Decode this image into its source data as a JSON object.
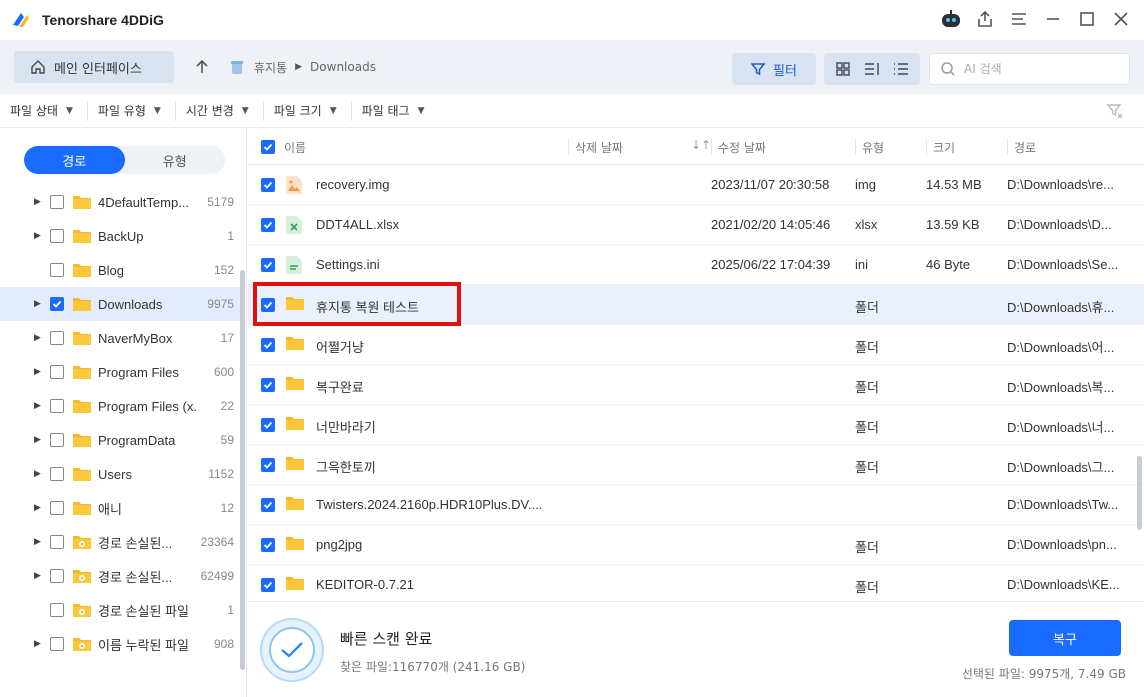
{
  "window": {
    "title": "Tenorshare 4DDiG"
  },
  "toolbar": {
    "home_label": "메인 인터페이스",
    "breadcrumb": [
      "휴지통",
      "Downloads"
    ],
    "filter_label": "필터",
    "search_placeholder": "AI 검색"
  },
  "filters": [
    "파일 상태",
    "파일 유형",
    "시간 변경",
    "파일 크기",
    "파일 태그"
  ],
  "sidebar": {
    "tabs": [
      "경로",
      "유형"
    ],
    "active_tab": 0,
    "items": [
      {
        "label": "4DefaultTemp...",
        "count": "5179",
        "expandable": true,
        "checked": false,
        "special": false
      },
      {
        "label": "BackUp",
        "count": "1",
        "expandable": true,
        "checked": false,
        "special": false
      },
      {
        "label": "Blog",
        "count": "152",
        "expandable": false,
        "checked": false,
        "special": false
      },
      {
        "label": "Downloads",
        "count": "9975",
        "expandable": true,
        "checked": true,
        "special": false,
        "selected": true
      },
      {
        "label": "NaverMyBox",
        "count": "17",
        "expandable": true,
        "checked": false,
        "special": false
      },
      {
        "label": "Program Files",
        "count": "600",
        "expandable": true,
        "checked": false,
        "special": false
      },
      {
        "label": "Program Files (x...",
        "count": "22",
        "expandable": true,
        "checked": false,
        "special": false
      },
      {
        "label": "ProgramData",
        "count": "59",
        "expandable": true,
        "checked": false,
        "special": false
      },
      {
        "label": "Users",
        "count": "1152",
        "expandable": true,
        "checked": false,
        "special": false
      },
      {
        "label": "애니",
        "count": "12",
        "expandable": true,
        "checked": false,
        "special": false
      },
      {
        "label": "경로 손실된...",
        "count": "23364",
        "expandable": true,
        "checked": false,
        "special": true
      },
      {
        "label": "경로 손실된...",
        "count": "62499",
        "expandable": true,
        "checked": false,
        "special": true
      },
      {
        "label": "경로 손실된 파일",
        "count": "1",
        "expandable": false,
        "checked": false,
        "special": true
      },
      {
        "label": "이름 누락된 파일",
        "count": "908",
        "expandable": true,
        "checked": false,
        "special": true
      }
    ]
  },
  "list": {
    "headers": {
      "name": "이름",
      "deleted": "삭제 날짜",
      "modified": "수정 날짜",
      "type": "유형",
      "size": "크기",
      "path": "경로"
    },
    "rows": [
      {
        "name": "recovery.img",
        "modified": "2023/11/07 20:30:58",
        "type": "img",
        "size": "14.53 MB",
        "path": "D:\\Downloads\\re...",
        "icon": "image-file-icon"
      },
      {
        "name": "DDT4ALL.xlsx",
        "modified": "2021/02/20 14:05:46",
        "type": "xlsx",
        "size": "13.59 KB",
        "path": "D:\\Downloads\\D...",
        "icon": "excel-file-icon"
      },
      {
        "name": "Settings.ini",
        "modified": "2025/06/22 17:04:39",
        "type": "ini",
        "size": "46 Byte",
        "path": "D:\\Downloads\\Se...",
        "icon": "ini-file-icon"
      },
      {
        "name": "휴지통 복원 테스트",
        "modified": "",
        "type": "폴더",
        "size": "",
        "path": "D:\\Downloads\\휴...",
        "icon": "folder-icon",
        "selected": true
      },
      {
        "name": "어쩔거냥",
        "modified": "",
        "type": "폴더",
        "size": "",
        "path": "D:\\Downloads\\어...",
        "icon": "folder-icon"
      },
      {
        "name": "복구완료",
        "modified": "",
        "type": "폴더",
        "size": "",
        "path": "D:\\Downloads\\복...",
        "icon": "folder-icon"
      },
      {
        "name": "너만바라기",
        "modified": "",
        "type": "폴더",
        "size": "",
        "path": "D:\\Downloads\\너...",
        "icon": "folder-icon"
      },
      {
        "name": "그윽한토끼",
        "modified": "",
        "type": "폴더",
        "size": "",
        "path": "D:\\Downloads\\그...",
        "icon": "folder-icon"
      },
      {
        "name": "Twisters.2024.2160p.HDR10Plus.DV....",
        "modified": "",
        "type": "",
        "size": "",
        "path": "D:\\Downloads\\Tw...",
        "icon": "folder-icon"
      },
      {
        "name": "png2jpg",
        "modified": "",
        "type": "폴더",
        "size": "",
        "path": "D:\\Downloads\\pn...",
        "icon": "folder-icon"
      },
      {
        "name": "KEDITOR-0.7.21",
        "modified": "",
        "type": "폴더",
        "size": "",
        "path": "D:\\Downloads\\KE...",
        "icon": "folder-icon"
      }
    ]
  },
  "footer": {
    "title": "빠른 스캔 완료",
    "found": "찾은 파일:116770개 (241.16 GB)",
    "recover_label": "복구",
    "selected_info": "선택된 파일: 9975개, 7.49 GB"
  },
  "colors": {
    "accent": "#1a6bff",
    "folder": "#f5b826",
    "highlight": "#e01010"
  }
}
